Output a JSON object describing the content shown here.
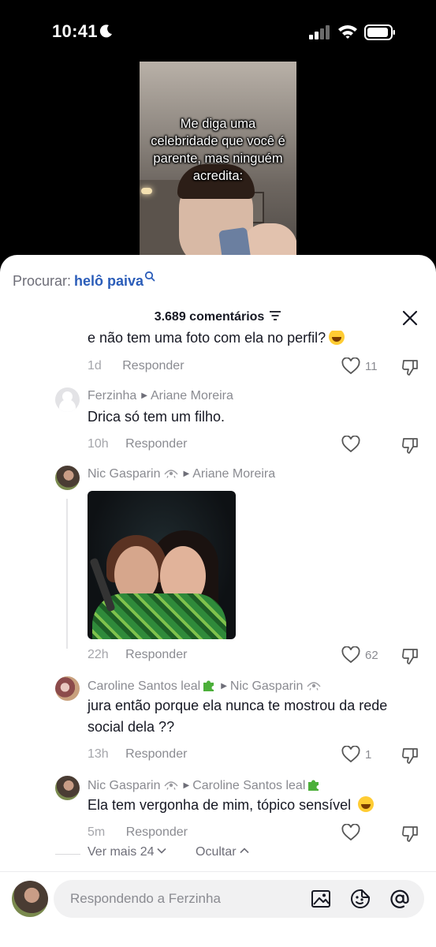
{
  "status_bar": {
    "time": "10:41"
  },
  "video": {
    "caption_lines": [
      "Me diga uma",
      "celebridade que você é",
      "parente, mas ninguém",
      "acredita:"
    ]
  },
  "search": {
    "label": "Procurar:",
    "term": "helô paiva"
  },
  "header": {
    "count_label": "3.689 comentários"
  },
  "comments": [
    {
      "partial_text": "e não tem uma foto com ela no perfil?",
      "time": "1d",
      "reply": "Responder",
      "likes": "11"
    },
    {
      "author": "Ferzinha",
      "reply_to": "Ariane Moreira",
      "text": "Drica só tem um filho.",
      "time": "10h",
      "reply": "Responder",
      "likes": ""
    },
    {
      "author": "Nic Gasparin",
      "reply_to": "Ariane Moreira",
      "time": "22h",
      "reply": "Responder",
      "likes": "62"
    },
    {
      "author": "Caroline Santos leal",
      "reply_to": "Nic Gasparin",
      "text": "jura então porque ela nunca te mostrou da rede social dela ??",
      "time": "13h",
      "reply": "Responder",
      "likes": "1"
    },
    {
      "author": "Nic Gasparin",
      "reply_to": "Caroline Santos leal",
      "text": "Ela tem vergonha de mim, tópico sensível",
      "time": "5m",
      "reply": "Responder",
      "likes": ""
    }
  ],
  "more": {
    "view_more": "Ver mais 24",
    "hide": "Ocultar"
  },
  "input": {
    "placeholder": "Respondendo a Ferzinha"
  }
}
